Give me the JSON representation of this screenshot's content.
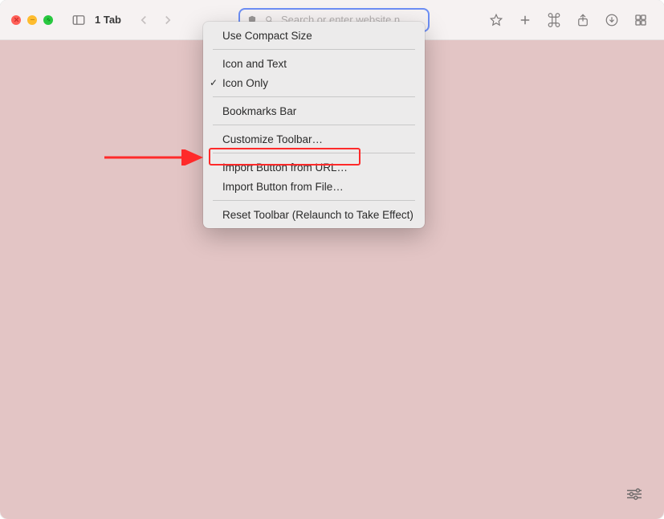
{
  "toolbar": {
    "tab_label": "1 Tab",
    "address_placeholder": "Search or enter website n"
  },
  "context_menu": {
    "items": [
      {
        "label": "Use Compact Size",
        "checked": false,
        "group": 0
      },
      {
        "label": "Icon and Text",
        "checked": false,
        "group": 1
      },
      {
        "label": "Icon Only",
        "checked": true,
        "group": 1
      },
      {
        "label": "Bookmarks Bar",
        "checked": false,
        "group": 2
      },
      {
        "label": "Customize Toolbar…",
        "checked": false,
        "group": 3
      },
      {
        "label": "Import Button from URL…",
        "checked": false,
        "group": 4,
        "highlighted": true
      },
      {
        "label": "Import Button from File…",
        "checked": false,
        "group": 4
      },
      {
        "label": "Reset Toolbar (Relaunch to Take Effect)",
        "checked": false,
        "group": 5
      }
    ]
  },
  "annotation": {
    "arrow_color": "#ff2a2a",
    "highlight_color": "#ff2a2a"
  }
}
